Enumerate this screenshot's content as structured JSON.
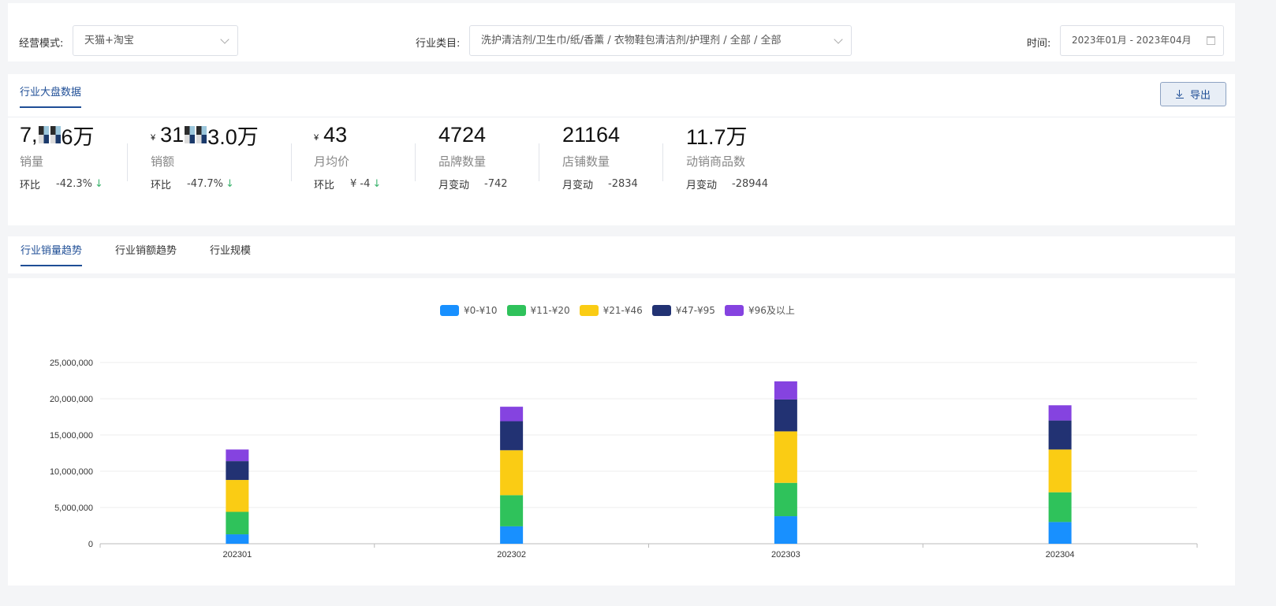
{
  "filters": {
    "mode_label": "经营模式:",
    "mode_value": "天猫+淘宝",
    "industry_label": "行业类目:",
    "industry_value": "洗护清洁剂/卫生巾/纸/香薰 / 衣物鞋包清洁剂/护理剂 / 全部 / 全部",
    "time_label": "时间:",
    "time_value": "2023年01月 - 2023年04月"
  },
  "kpi_section": {
    "tab": "行业大盘数据",
    "export_label": "导出",
    "currency": "¥",
    "metrics": [
      {
        "value_a": "7,",
        "value_b": "6万",
        "currency": false,
        "label": "销量",
        "change_label": "环比",
        "change_value": "-42.3%",
        "down": true
      },
      {
        "value_a": "31",
        "value_b": "3.0万",
        "currency": true,
        "label": "销额",
        "change_label": "环比",
        "change_value": "-47.7%",
        "down": true
      },
      {
        "value_a": "43",
        "value_b": "",
        "currency": true,
        "label": "月均价",
        "change_label": "环比",
        "change_value": "¥ -4",
        "down": true
      },
      {
        "value_a": "4724",
        "value_b": "",
        "currency": false,
        "label": "品牌数量",
        "change_label": "月变动",
        "change_value": "-742",
        "down": false
      },
      {
        "value_a": "21164",
        "value_b": "",
        "currency": false,
        "label": "店铺数量",
        "change_label": "月变动",
        "change_value": "-2834",
        "down": false
      },
      {
        "value_a": "11.7万",
        "value_b": "",
        "currency": false,
        "label": "动销商品数",
        "change_label": "月变动",
        "change_value": "-28944",
        "down": false
      }
    ]
  },
  "trend_tabs": [
    "行业销量趋势",
    "行业销额趋势",
    "行业规模"
  ],
  "active_tab": 0,
  "chart_data": {
    "type": "bar",
    "stacked": true,
    "categories": [
      "202301",
      "202302",
      "202303",
      "202304"
    ],
    "series": [
      {
        "name": "¥0-¥10",
        "color": "#1890ff",
        "values": [
          1300000,
          2400000,
          3800000,
          3000000
        ]
      },
      {
        "name": "¥11-¥20",
        "color": "#2fc25b",
        "values": [
          3100000,
          4300000,
          4600000,
          4100000
        ]
      },
      {
        "name": "¥21-¥46",
        "color": "#facc14",
        "values": [
          4400000,
          6200000,
          7100000,
          5900000
        ]
      },
      {
        "name": "¥47-¥95",
        "color": "#223273",
        "values": [
          2600000,
          4000000,
          4400000,
          4000000
        ]
      },
      {
        "name": "¥96及以上",
        "color": "#8543e0",
        "values": [
          1600000,
          2000000,
          2500000,
          2100000
        ]
      }
    ],
    "yticks": [
      "0",
      "5,000,000",
      "10,000,000",
      "15,000,000",
      "20,000,000",
      "25,000,000"
    ],
    "ylim": [
      0,
      25000000
    ],
    "legend_position": "top-center",
    "grid": true
  }
}
